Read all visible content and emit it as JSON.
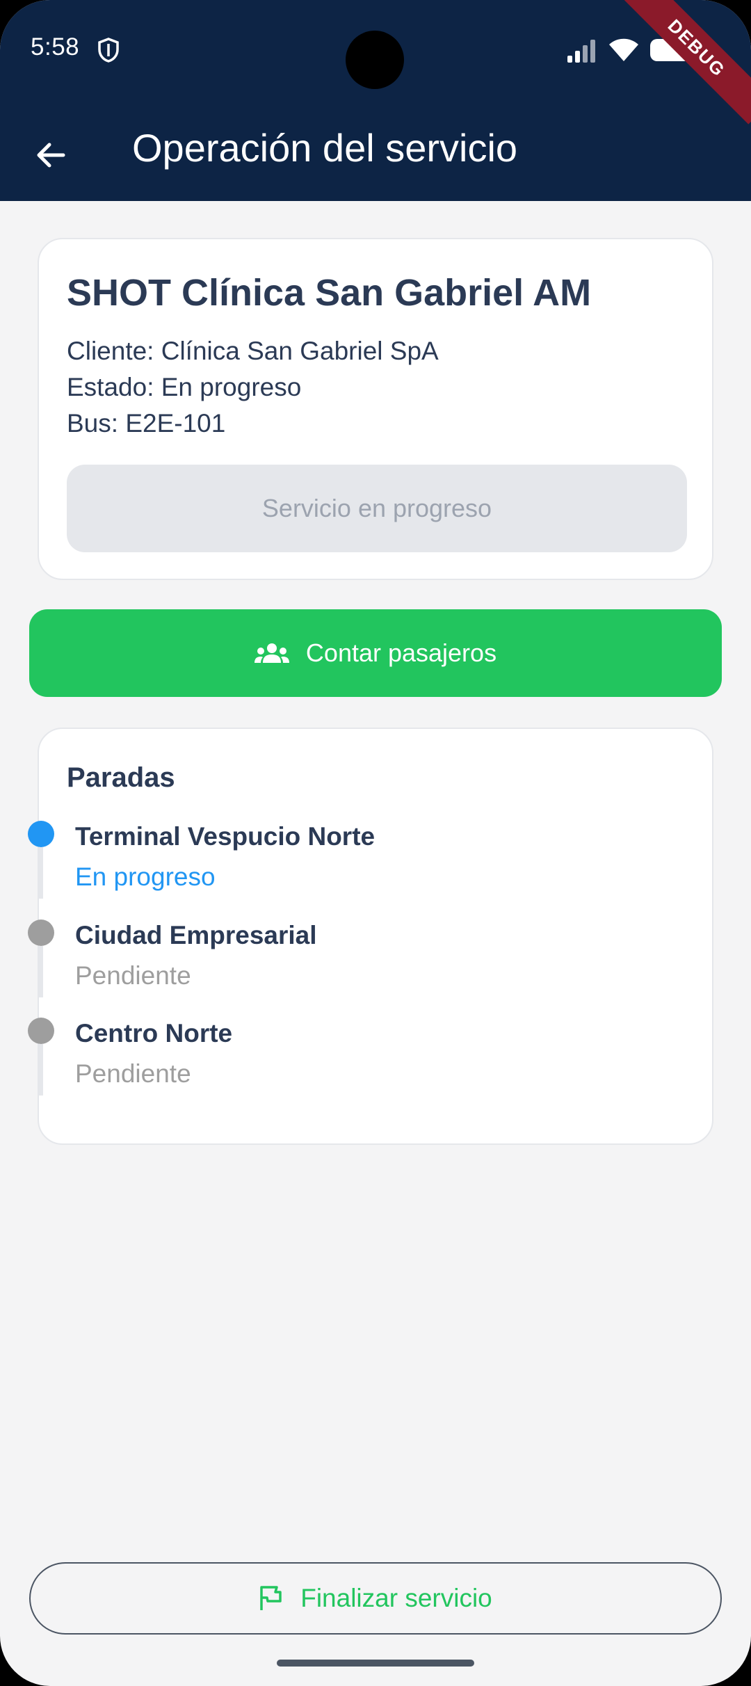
{
  "status_bar": {
    "time": "5:58",
    "debug_label": "DEBUG"
  },
  "app_bar": {
    "title": "Operación del servicio"
  },
  "service": {
    "title": "SHOT Clínica San Gabriel AM",
    "client": "Cliente: Clínica San Gabriel SpA",
    "state": "Estado: En progreso",
    "bus": "Bus: E2E-101",
    "status_button": "Servicio en progreso"
  },
  "count_button": {
    "label": "Contar pasajeros"
  },
  "stops": {
    "title": "Paradas",
    "items": [
      {
        "name": "Terminal Vespucio Norte",
        "status": "En progreso",
        "dot_color": "#2196f3",
        "status_color": "#2196f3"
      },
      {
        "name": "Ciudad Empresarial",
        "status": "Pendiente",
        "dot_color": "#9e9e9e",
        "status_color": "#9e9e9e"
      },
      {
        "name": "Centro Norte",
        "status": "Pendiente",
        "dot_color": "#9e9e9e",
        "status_color": "#9e9e9e"
      }
    ]
  },
  "finish_button": {
    "label": "Finalizar servicio"
  },
  "colors": {
    "app_bar": "#0d2445",
    "accent_green": "#22c55e",
    "text_dark": "#2b3a55"
  },
  "icons": [
    "back-arrow-icon",
    "shield-icon",
    "signal-icon",
    "wifi-icon",
    "battery-icon",
    "people-icon",
    "flag-icon"
  ]
}
